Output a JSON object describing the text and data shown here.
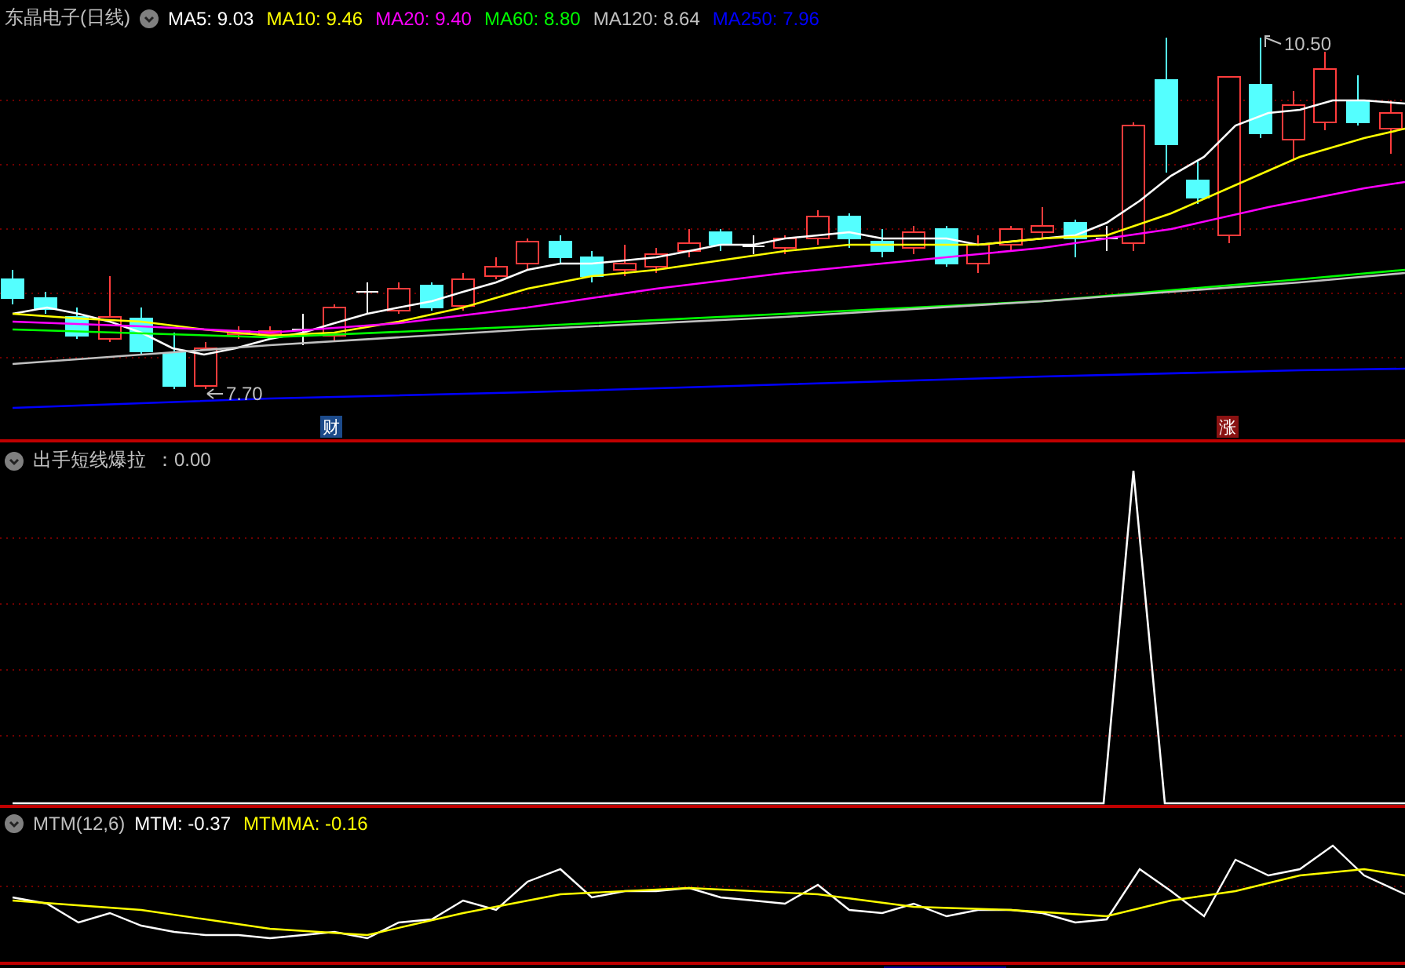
{
  "price_panel": {
    "title": "东晶电子(日线)",
    "indicators": [
      {
        "label": "MA5: 9.03",
        "color": "#ffffff"
      },
      {
        "label": "MA10: 9.46",
        "color": "#ffff00"
      },
      {
        "label": "MA20: 9.40",
        "color": "#ff00ff"
      },
      {
        "label": "MA60: 8.80",
        "color": "#00ff00"
      },
      {
        "label": "MA120: 8.64",
        "color": "#c0c0c0"
      },
      {
        "label": "MA250: 7.96",
        "color": "#0000ff"
      }
    ],
    "low_label": "7.70",
    "high_label": "10.50",
    "markers": [
      {
        "text": "财",
        "color": "#1c4a8a"
      },
      {
        "text": "涨",
        "color": "#8a1212"
      }
    ]
  },
  "signal_panel": {
    "title": "出手短线爆拉",
    "value": "：0.00"
  },
  "mtm_panel": {
    "title": "MTM(12,6)",
    "indicators": [
      {
        "label": "MTM: -0.37",
        "color": "#ffffff"
      },
      {
        "label": "MTMMA: -0.16",
        "color": "#ffff00"
      }
    ]
  }
}
